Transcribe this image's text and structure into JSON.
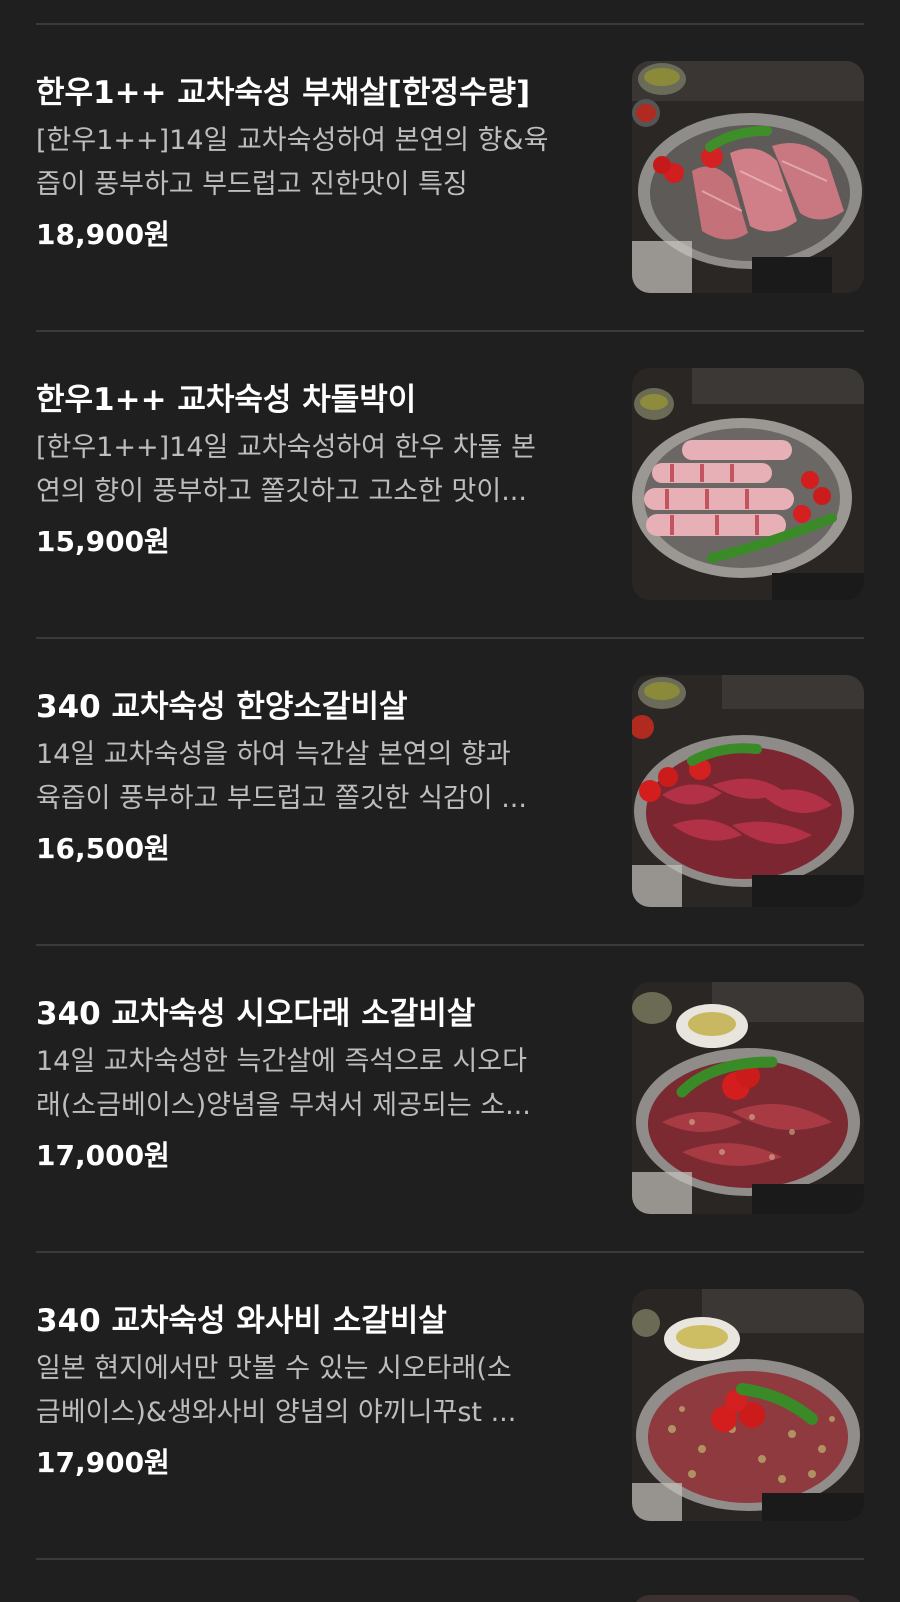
{
  "menu_items": [
    {
      "title": "한우1++ 교차숙성 부채살[한정수량]",
      "desc_line1": "[한우1++]14일 교차숙성하여 본연의 향&육",
      "desc_line2": "즙이 풍부하고 부드럽고 진한맛이 특징",
      "price": "18,900원",
      "image_icon": "flat-iron-steak-photo"
    },
    {
      "title": "한우1++ 교차숙성 차돌박이",
      "desc_line1": "[한우1++]14일 교차숙성하여 한우 차돌 본",
      "desc_line2": "연의 향이 풍부하고 쫄깃하고 고소한 맛이...",
      "price": "15,900원",
      "image_icon": "brisket-rolls-photo"
    },
    {
      "title": "340 교차숙성 한양소갈비살",
      "desc_line1": "14일 교차숙성을 하여 늑간살 본연의 향과",
      "desc_line2": "육즙이 풍부하고 부드럽고 쫄깃한 식감이 ...",
      "price": "16,500원",
      "image_icon": "short-rib-photo"
    },
    {
      "title": "340 교차숙성 시오다래 소갈비살",
      "desc_line1": "14일 교차숙성한 늑간살에 즉석으로 시오다",
      "desc_line2": "래(소금베이스)양념을 무쳐서 제공되는 소...",
      "price": "17,000원",
      "image_icon": "shiodare-rib-photo"
    },
    {
      "title": "340 교차숙성 와사비 소갈비살",
      "desc_line1": "일본 현지에서만 맛볼 수 있는 시오타래(소",
      "desc_line2": "금베이스)&생와사비 양념의 야끼니꾸st ...",
      "price": "17,900원",
      "image_icon": "wasabi-rib-photo"
    }
  ]
}
